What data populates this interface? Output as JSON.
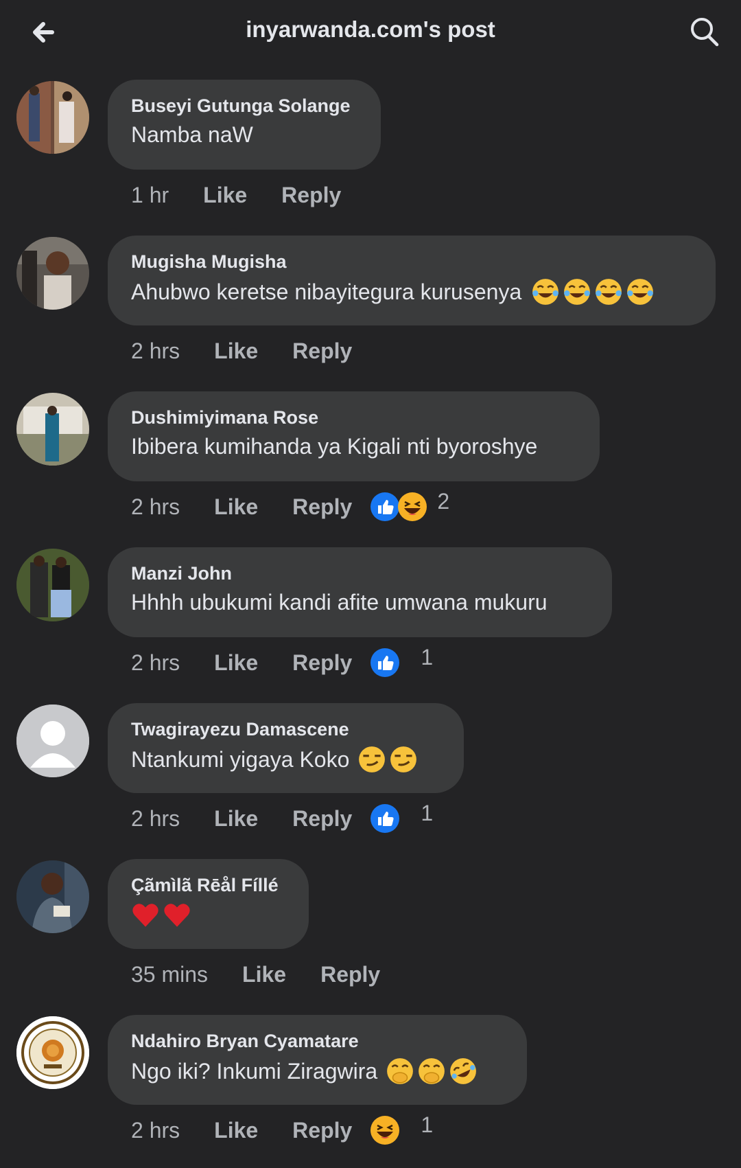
{
  "header": {
    "title": "inyarwanda.com's post",
    "back_icon": "back-arrow-icon",
    "search_icon": "search-icon"
  },
  "actions": {
    "like": "Like",
    "reply": "Reply"
  },
  "comments": [
    {
      "author": "Buseyi Gutunga Solange",
      "text": "Namba naW",
      "time": "1 hr",
      "emojis": [],
      "reactions": [],
      "reaction_count": ""
    },
    {
      "author": "Mugisha Mugisha",
      "text": "Ahubwo keretse nibayitegura kurusenya",
      "time": "2 hrs",
      "emojis": [
        "tears-of-joy",
        "tears-of-joy",
        "tears-of-joy",
        "tears-of-joy"
      ],
      "reactions": [],
      "reaction_count": ""
    },
    {
      "author": "Dushimiyimana Rose",
      "text": "Ibibera kumihanda ya Kigali nti byoroshye",
      "time": "2 hrs",
      "emojis": [],
      "reactions": [
        "like",
        "haha"
      ],
      "reaction_count": "2"
    },
    {
      "author": "Manzi John",
      "text": "Hhhh ubukumi kandi afite umwana mukuru",
      "time": "2 hrs",
      "emojis": [],
      "reactions": [
        "like"
      ],
      "reaction_count": "1"
    },
    {
      "author": "Twagirayezu Damascene",
      "text": "Ntankumi yigaya Koko",
      "time": "2 hrs",
      "emojis": [
        "smirk",
        "smirk"
      ],
      "reactions": [
        "like"
      ],
      "reaction_count": "1"
    },
    {
      "author": "Çãmìlã Rēål Fíllé",
      "text": "",
      "time": "35 mins",
      "emojis": [
        "heart",
        "heart"
      ],
      "reactions": [],
      "reaction_count": ""
    },
    {
      "author": "Ndahiro Bryan Cyamatare",
      "text": "Ngo iki? Inkumi Ziragwira",
      "time": "2 hrs",
      "emojis": [
        "hand-over-mouth",
        "hand-over-mouth",
        "rolling-laughing"
      ],
      "reactions": [
        "haha"
      ],
      "reaction_count": "1"
    }
  ],
  "colors": {
    "background": "#232325",
    "bubble": "#3a3b3c",
    "like_blue": "#1877f2",
    "muted": "#b0b3b8"
  }
}
